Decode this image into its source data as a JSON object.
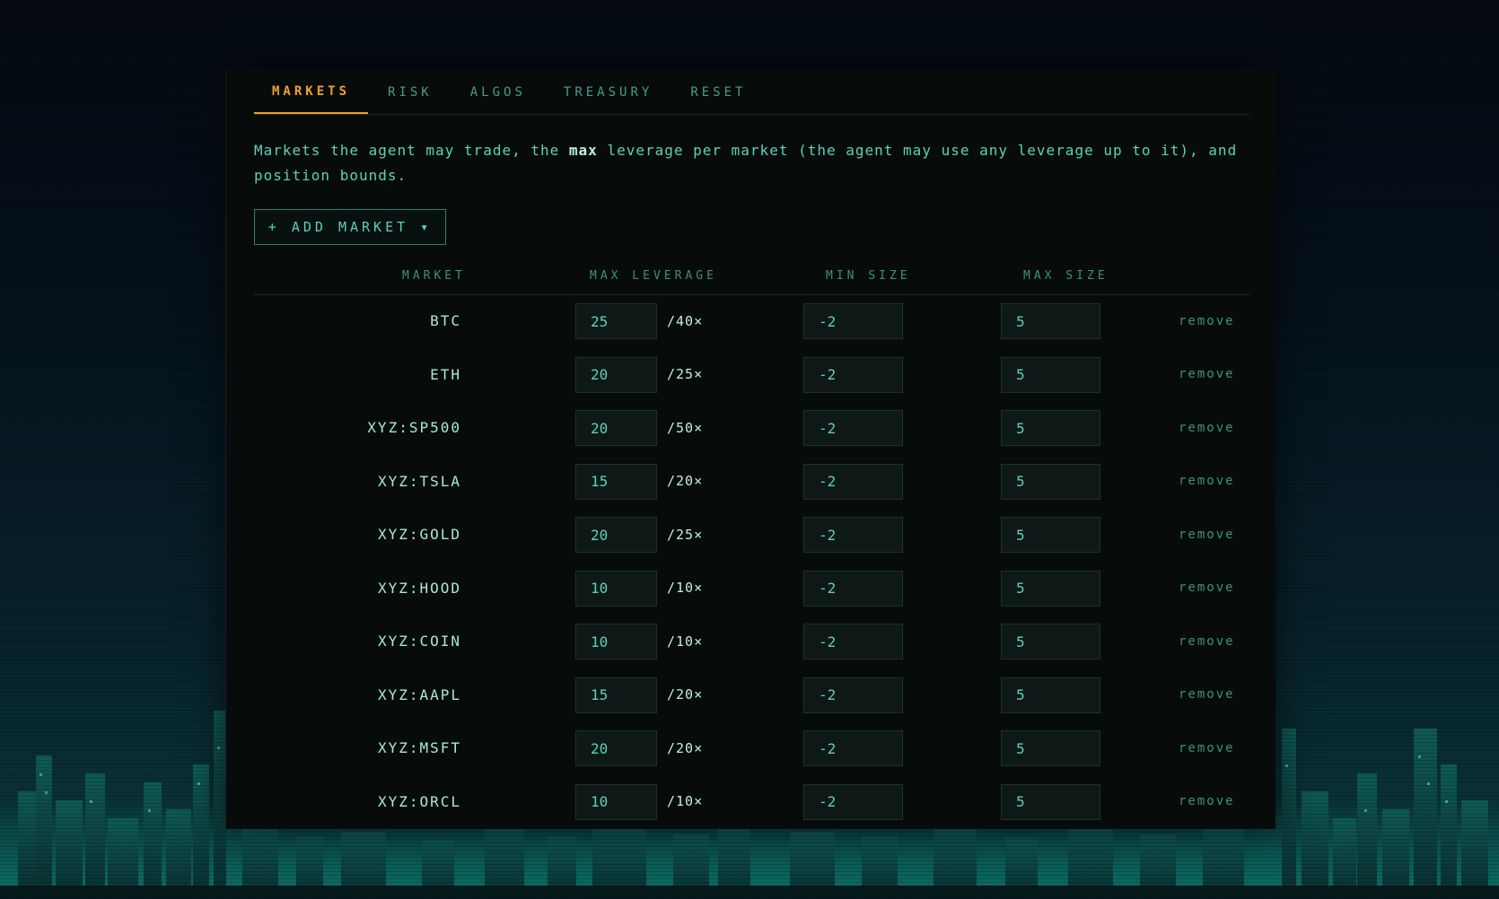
{
  "colors": {
    "accent": "#f0a030",
    "text": "#5ed0b8",
    "panel_bg": "#070c0b",
    "input_bg": "#0e1917"
  },
  "tabs": [
    {
      "label": "MARKETS",
      "active": true
    },
    {
      "label": "RISK",
      "active": false
    },
    {
      "label": "ALGOS",
      "active": false
    },
    {
      "label": "TREASURY",
      "active": false
    },
    {
      "label": "RESET",
      "active": false
    }
  ],
  "description": {
    "before": "Markets the agent may trade, the ",
    "emphasis": "max",
    "after": " leverage per market (the agent may use any leverage up to it), and position bounds."
  },
  "add_market_button": {
    "label": "+ ADD MARKET ▾"
  },
  "table": {
    "headers": {
      "market": "MARKET",
      "max_leverage": "MAX LEVERAGE",
      "min_size": "MIN SIZE",
      "max_size": "MAX SIZE"
    },
    "remove_label": "remove",
    "rows": [
      {
        "market": "BTC",
        "leverage": "25",
        "cap": "/40×",
        "min": "-2",
        "max": "5"
      },
      {
        "market": "ETH",
        "leverage": "20",
        "cap": "/25×",
        "min": "-2",
        "max": "5"
      },
      {
        "market": "XYZ:SP500",
        "leverage": "20",
        "cap": "/50×",
        "min": "-2",
        "max": "5"
      },
      {
        "market": "XYZ:TSLA",
        "leverage": "15",
        "cap": "/20×",
        "min": "-2",
        "max": "5"
      },
      {
        "market": "XYZ:GOLD",
        "leverage": "20",
        "cap": "/25×",
        "min": "-2",
        "max": "5"
      },
      {
        "market": "XYZ:HOOD",
        "leverage": "10",
        "cap": "/10×",
        "min": "-2",
        "max": "5"
      },
      {
        "market": "XYZ:COIN",
        "leverage": "10",
        "cap": "/10×",
        "min": "-2",
        "max": "5"
      },
      {
        "market": "XYZ:AAPL",
        "leverage": "15",
        "cap": "/20×",
        "min": "-2",
        "max": "5"
      },
      {
        "market": "XYZ:MSFT",
        "leverage": "20",
        "cap": "/20×",
        "min": "-2",
        "max": "5"
      },
      {
        "market": "XYZ:ORCL",
        "leverage": "10",
        "cap": "/10×",
        "min": "-2",
        "max": "5"
      }
    ]
  }
}
